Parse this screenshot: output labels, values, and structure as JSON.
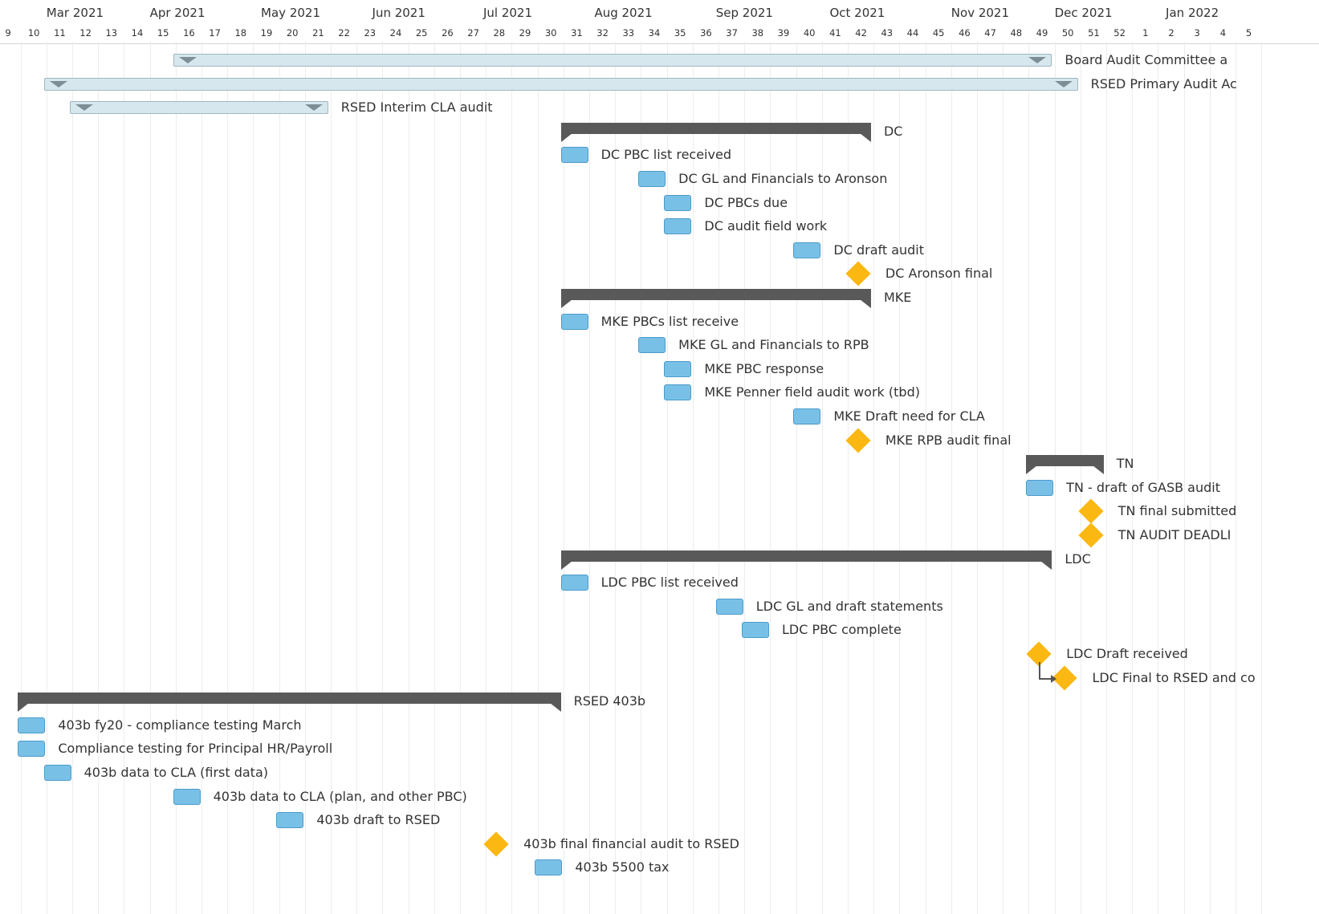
{
  "timeline": {
    "months": [
      {
        "label": "Mar 2021",
        "week": 10.5
      },
      {
        "label": "Apr 2021",
        "week": 14.5
      },
      {
        "label": "May 2021",
        "week": 18.8
      },
      {
        "label": "Jun 2021",
        "week": 23.1
      },
      {
        "label": "Jul 2021",
        "week": 27.4
      },
      {
        "label": "Aug 2021",
        "week": 31.7
      },
      {
        "label": "Sep 2021",
        "week": 36.4
      },
      {
        "label": "Oct 2021",
        "week": 40.8
      },
      {
        "label": "Nov 2021",
        "week": 45.5
      },
      {
        "label": "Dec 2021",
        "week": 49.5
      },
      {
        "label": "Jan 2022",
        "week": 53.8
      }
    ],
    "weeks": [
      "9",
      "10",
      "11",
      "12",
      "13",
      "14",
      "15",
      "16",
      "17",
      "18",
      "19",
      "20",
      "21",
      "22",
      "23",
      "24",
      "25",
      "26",
      "27",
      "28",
      "29",
      "30",
      "31",
      "32",
      "33",
      "34",
      "35",
      "36",
      "37",
      "38",
      "39",
      "40",
      "41",
      "42",
      "43",
      "44",
      "45",
      "46",
      "47",
      "48",
      "49",
      "50",
      "51",
      "52",
      "1",
      "2",
      "3",
      "4",
      "5"
    ]
  },
  "rows": [
    {
      "type": "summary",
      "label": "Board Audit Committee a",
      "start": 15.4,
      "end": 49.4
    },
    {
      "type": "summary",
      "label": "RSED Primary Audit Ac",
      "start": 10.4,
      "end": 50.4
    },
    {
      "type": "summary",
      "label": "RSED Interim CLA audit",
      "start": 11.4,
      "end": 21.4
    },
    {
      "type": "group",
      "label": "DC",
      "start": 30.4,
      "end": 42.4
    },
    {
      "type": "task",
      "label": "DC PBC list received",
      "start": 30.4
    },
    {
      "type": "task",
      "label": "DC GL and Financials to Aronson",
      "start": 33.4
    },
    {
      "type": "task",
      "label": "DC PBCs due",
      "start": 34.4
    },
    {
      "type": "task",
      "label": "DC audit field work",
      "start": 34.4
    },
    {
      "type": "task",
      "label": "DC draft audit",
      "start": 39.4
    },
    {
      "type": "milestone",
      "label": "DC Aronson final",
      "at": 41.9
    },
    {
      "type": "group",
      "label": "MKE",
      "start": 30.4,
      "end": 42.4
    },
    {
      "type": "task",
      "label": "MKE PBCs list receive",
      "start": 30.4
    },
    {
      "type": "task",
      "label": "MKE GL and Financials to RPB",
      "start": 33.4
    },
    {
      "type": "task",
      "label": "MKE PBC response",
      "start": 34.4
    },
    {
      "type": "task",
      "label": "MKE Penner field audit work (tbd)",
      "start": 34.4
    },
    {
      "type": "task",
      "label": "MKE Draft need for CLA",
      "start": 39.4
    },
    {
      "type": "milestone",
      "label": "MKE RPB audit final",
      "at": 41.9
    },
    {
      "type": "group",
      "label": "TN",
      "start": 48.4,
      "end": 51.4
    },
    {
      "type": "task",
      "label": "TN - draft of GASB audit",
      "start": 48.4
    },
    {
      "type": "milestone",
      "label": "TN final submitted",
      "at": 50.9
    },
    {
      "type": "milestone",
      "label": "TN AUDIT DEADLI",
      "at": 50.9
    },
    {
      "type": "group",
      "label": "LDC",
      "start": 30.4,
      "end": 49.4
    },
    {
      "type": "task",
      "label": "LDC PBC list received",
      "start": 30.4
    },
    {
      "type": "task",
      "label": "LDC GL and draft statements",
      "start": 36.4
    },
    {
      "type": "task",
      "label": "LDC PBC complete",
      "start": 37.4
    },
    {
      "type": "milestone",
      "label": "LDC Draft received",
      "at": 48.9
    },
    {
      "type": "milestone",
      "label": "LDC Final to RSED and co",
      "at": 49.9,
      "linked": true
    },
    {
      "type": "group",
      "label": "RSED 403b",
      "start": 9.4,
      "end": 30.4
    },
    {
      "type": "task",
      "label": "403b fy20 - compliance testing March",
      "start": 9.4
    },
    {
      "type": "task",
      "label": "Compliance testing for Principal HR/Payroll",
      "start": 9.4
    },
    {
      "type": "task",
      "label": "403b data to CLA (first data)",
      "start": 10.4
    },
    {
      "type": "task",
      "label": "403b data to CLA (plan, and other PBC)",
      "start": 15.4
    },
    {
      "type": "task",
      "label": "403b draft to RSED",
      "start": 19.4
    },
    {
      "type": "milestone",
      "label": "403b final financial audit to RSED",
      "at": 27.9
    },
    {
      "type": "task",
      "label": "403b 5500 tax",
      "start": 29.4
    }
  ],
  "colors": {
    "task": "#79c0e7",
    "milestone": "#fbb712",
    "group": "#595959",
    "summary": "#d6e7ee"
  }
}
